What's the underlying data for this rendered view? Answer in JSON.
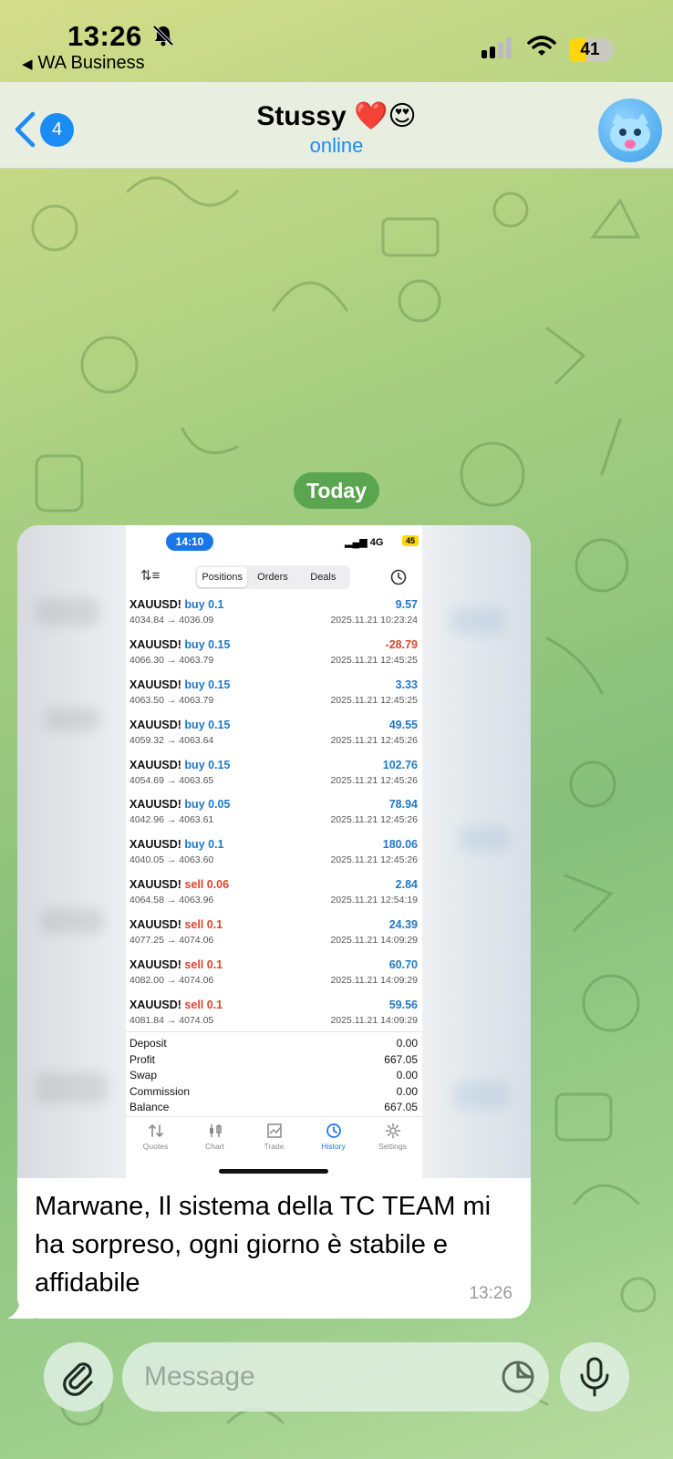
{
  "status_bar": {
    "time": "13:26",
    "back_app": "WA Business",
    "battery": "41",
    "battery_level_percent": 41,
    "icons": [
      "bell-slash-icon",
      "signal-icon",
      "wifi-icon",
      "battery-icon"
    ]
  },
  "header": {
    "back_badge": "4",
    "title": "Stussy ❤️😍",
    "subtitle": "online",
    "accent_color": "#1a8cf5"
  },
  "date_chip": "Today",
  "message": {
    "text": "Marwane, Il sistema della TC TEAM mi ha sorpreso, ogni giorno è stabile e affidabile",
    "time": "13:26",
    "screenshot": {
      "status_time": "14:10",
      "network": "4G",
      "battery": "45",
      "tabs": [
        {
          "label": "Positions",
          "active": true
        },
        {
          "label": "Orders",
          "active": false
        },
        {
          "label": "Deals",
          "active": false
        }
      ],
      "trades": [
        {
          "symbol": "XAUUSD!",
          "side": "buy",
          "volume": "buy 0.1",
          "prices": "4034.84 → 4036.09",
          "profit": "9.57",
          "date": "2025.11.21 10:23:24"
        },
        {
          "symbol": "XAUUSD!",
          "side": "buy",
          "volume": "buy 0.15",
          "prices": "4066.30 → 4063.79",
          "profit": "-28.79",
          "date": "2025.11.21 12:45:25"
        },
        {
          "symbol": "XAUUSD!",
          "side": "buy",
          "volume": "buy 0.15",
          "prices": "4063.50 → 4063.79",
          "profit": "3.33",
          "date": "2025.11.21 12:45:25"
        },
        {
          "symbol": "XAUUSD!",
          "side": "buy",
          "volume": "buy 0.15",
          "prices": "4059.32 → 4063.64",
          "profit": "49.55",
          "date": "2025.11.21 12:45:26"
        },
        {
          "symbol": "XAUUSD!",
          "side": "buy",
          "volume": "buy 0.15",
          "prices": "4054.69 → 4063.65",
          "profit": "102.76",
          "date": "2025.11.21 12:45:26"
        },
        {
          "symbol": "XAUUSD!",
          "side": "buy",
          "volume": "buy 0.05",
          "prices": "4042.96 → 4063.61",
          "profit": "78.94",
          "date": "2025.11.21 12:45:26"
        },
        {
          "symbol": "XAUUSD!",
          "side": "buy",
          "volume": "buy 0.1",
          "prices": "4040.05 → 4063.60",
          "profit": "180.06",
          "date": "2025.11.21 12:45:26"
        },
        {
          "symbol": "XAUUSD!",
          "side": "sell",
          "volume": "sell 0.06",
          "prices": "4064.58 → 4063.96",
          "profit": "2.84",
          "date": "2025.11.21 12:54:19"
        },
        {
          "symbol": "XAUUSD!",
          "side": "sell",
          "volume": "sell 0.1",
          "prices": "4077.25 → 4074.06",
          "profit": "24.39",
          "date": "2025.11.21 14:09:29"
        },
        {
          "symbol": "XAUUSD!",
          "side": "sell",
          "volume": "sell 0.1",
          "prices": "4082.00 → 4074.06",
          "profit": "60.70",
          "date": "2025.11.21 14:09:29"
        },
        {
          "symbol": "XAUUSD!",
          "side": "sell",
          "volume": "sell 0.1",
          "prices": "4081.84 → 4074.05",
          "profit": "59.56",
          "date": "2025.11.21 14:09:29"
        }
      ],
      "summary": [
        {
          "label": "Deposit",
          "value": "0.00"
        },
        {
          "label": "Profit",
          "value": "667.05"
        },
        {
          "label": "Swap",
          "value": "0.00"
        },
        {
          "label": "Commission",
          "value": "0.00"
        },
        {
          "label": "Balance",
          "value": "667.05"
        }
      ],
      "tabbar": [
        {
          "label": "Quotes",
          "icon": "quotes-arrows-icon",
          "active": false
        },
        {
          "label": "Chart",
          "icon": "candlestick-icon",
          "active": false
        },
        {
          "label": "Trade",
          "icon": "trade-line-chart-icon",
          "active": false
        },
        {
          "label": "History",
          "icon": "history-clock-icon",
          "active": true
        },
        {
          "label": "Settings",
          "icon": "gear-icon",
          "active": false
        }
      ],
      "colors": {
        "buy": "#1f78c8",
        "sell": "#d9452b",
        "accent": "#1976e8"
      }
    }
  },
  "input": {
    "placeholder": "Message",
    "icons": [
      "paperclip-icon",
      "sticker-icon",
      "microphone-icon"
    ]
  }
}
